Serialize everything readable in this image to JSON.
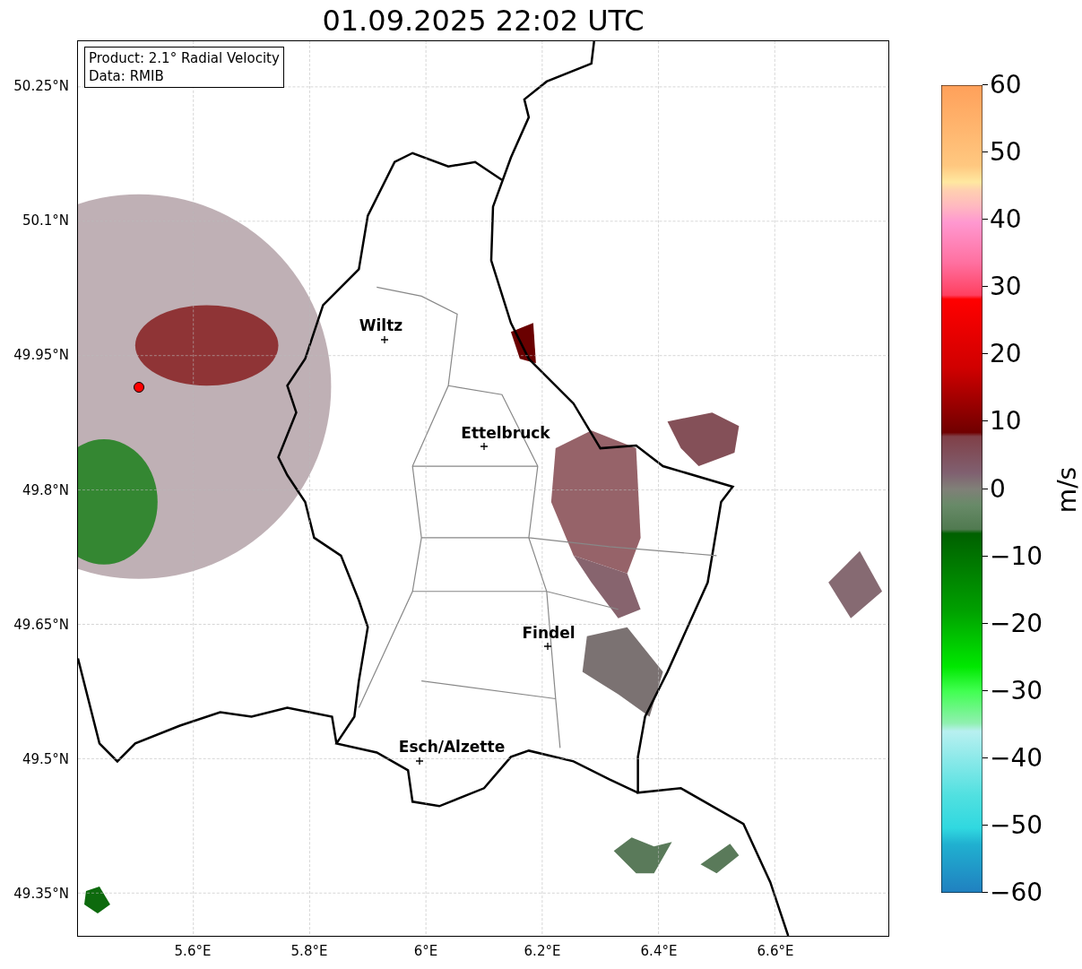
{
  "title": "01.09.2025 22:02 UTC",
  "info_box": {
    "lines": [
      "Product: 2.1° Radial Velocity",
      "Data: RMIB"
    ]
  },
  "map": {
    "cities": [
      {
        "name": "Wiltz"
      },
      {
        "name": "Ettelbruck"
      },
      {
        "name": "Findel"
      },
      {
        "name": "Esch/Alzette"
      }
    ],
    "lat_ticks": [
      "50.25°N",
      "50.1°N",
      "49.95°N",
      "49.8°N",
      "49.65°N",
      "49.5°N",
      "49.35°N"
    ],
    "lon_ticks": [
      "5.6°E",
      "5.8°E",
      "6°E",
      "6.2°E",
      "6.4°E",
      "6.6°E"
    ]
  },
  "colorbar": {
    "label": "m/s",
    "ticks": [
      "60",
      "50",
      "40",
      "30",
      "20",
      "10",
      "0",
      "−10",
      "−20",
      "−30",
      "−40",
      "−50",
      "−60"
    ]
  }
}
